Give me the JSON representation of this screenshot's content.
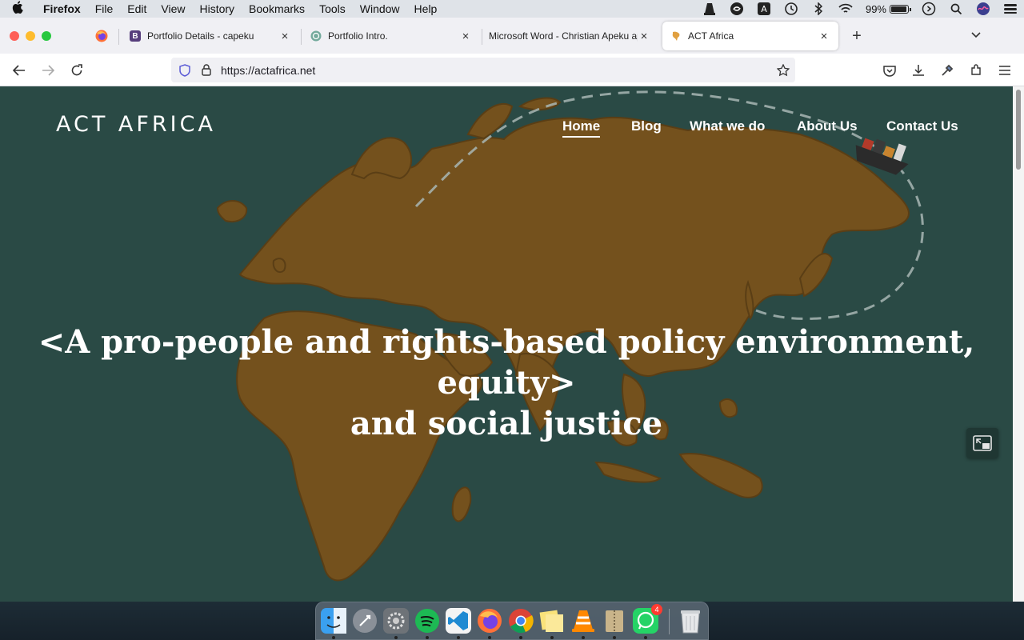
{
  "menubar": {
    "app_name": "Firefox",
    "items": [
      "File",
      "Edit",
      "View",
      "History",
      "Bookmarks",
      "Tools",
      "Window",
      "Help"
    ],
    "battery_percent": "99%",
    "battery_level": 0.99,
    "icons": [
      "vlc-icon",
      "sync-icon",
      "keyboard-a-icon",
      "time-machine-icon",
      "bluetooth-icon",
      "wifi-icon",
      "battery-icon",
      "play-circle-icon",
      "search-icon",
      "siri-icon",
      "control-center-icon"
    ]
  },
  "tabs": [
    {
      "title": "Portfolio Details - capeku",
      "favicon": "B",
      "favicon_color": "#563d7c",
      "active": false
    },
    {
      "title": "Portfolio Intro.",
      "favicon": "openai-icon",
      "favicon_color": "#74aa9c",
      "active": false
    },
    {
      "title": "Microsoft Word - Christian Apeku ap",
      "favicon": "",
      "favicon_color": "",
      "active": false
    },
    {
      "title": "ACT Africa",
      "favicon": "act-icon",
      "favicon_color": "#e0a040",
      "active": true
    }
  ],
  "toolbar": {
    "url": "https://actafrica.net"
  },
  "site": {
    "logo": "ACT AFRICA",
    "nav": [
      "Home",
      "Blog",
      "What we do",
      "About Us",
      "Contact Us"
    ],
    "nav_current": "Home",
    "hero_line1": "<A pro-people and rights-based policy environment, equity>",
    "hero_line2": "and social justice",
    "colors": {
      "background": "#2a4a45",
      "land": "#74511d",
      "text": "#ffffff"
    }
  },
  "dock": {
    "apps": [
      "Finder",
      "Launchpad",
      "System Preferences",
      "Spotify",
      "Visual Studio Code",
      "Firefox",
      "Google Chrome",
      "Stickies",
      "VLC",
      "Archive Utility",
      "WhatsApp",
      "Trash"
    ],
    "whatsapp_badge": "4"
  }
}
